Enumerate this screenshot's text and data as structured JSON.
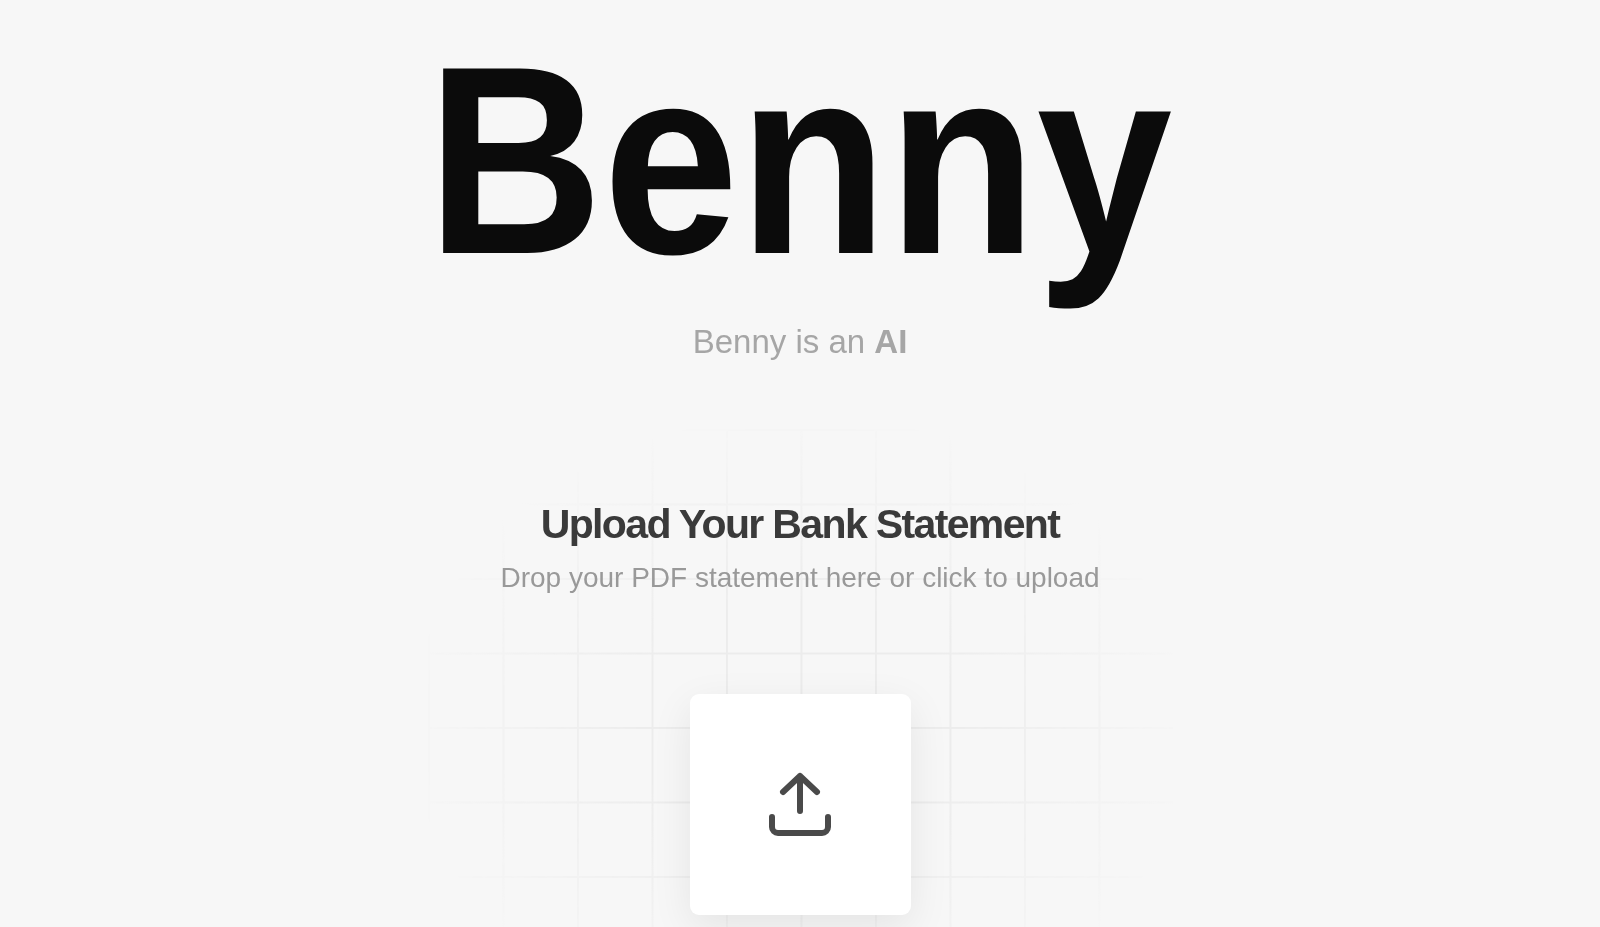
{
  "logo": "Benny",
  "tagline": "Benny is an **AI**",
  "upload": {
    "title": "Upload Your Bank Statement",
    "hint": "Drop your PDF statement here or click to upload"
  }
}
